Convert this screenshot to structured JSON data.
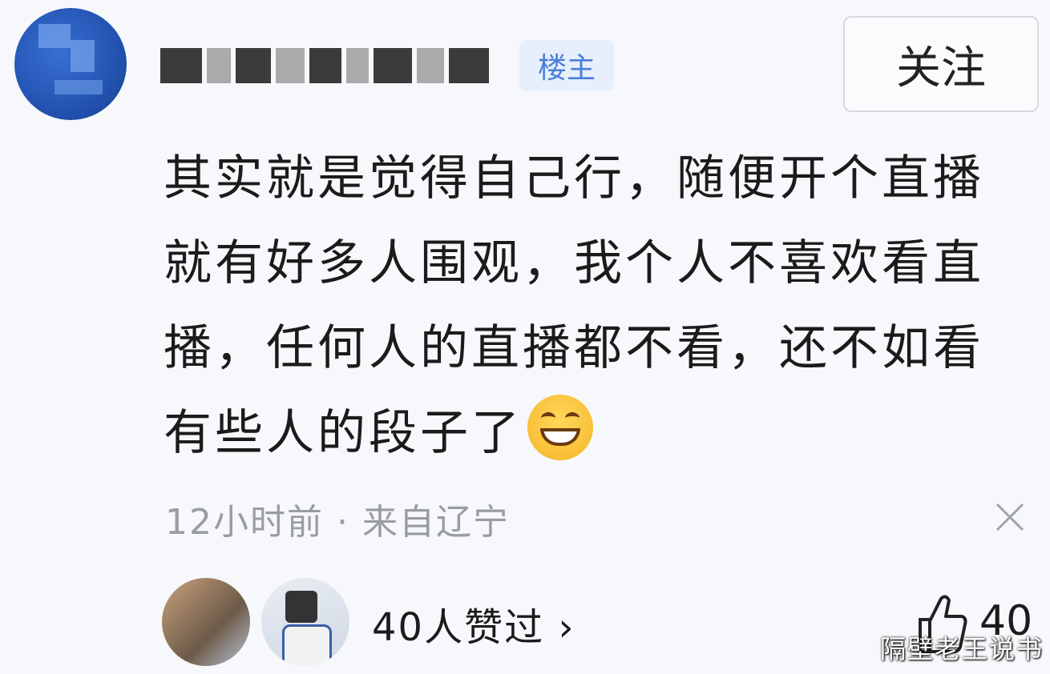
{
  "post": {
    "owner_badge": "楼主",
    "follow_label": "关注",
    "comment_text": "其实就是觉得自己行，随便开个直播就有好多人围观，我个人不喜欢看直播，任何人的直播都不看，还不如看有些人的段子了",
    "emoji": "grinning-face",
    "meta": "12小时前 · 来自辽宁"
  },
  "likes": {
    "summary": "40人赞过 ›",
    "count": "40"
  },
  "watermark": "隔壁老王说书",
  "colors": {
    "badge_bg": "#e6effb",
    "badge_text": "#4a7ed9",
    "meta_text": "#9a9ca4"
  }
}
